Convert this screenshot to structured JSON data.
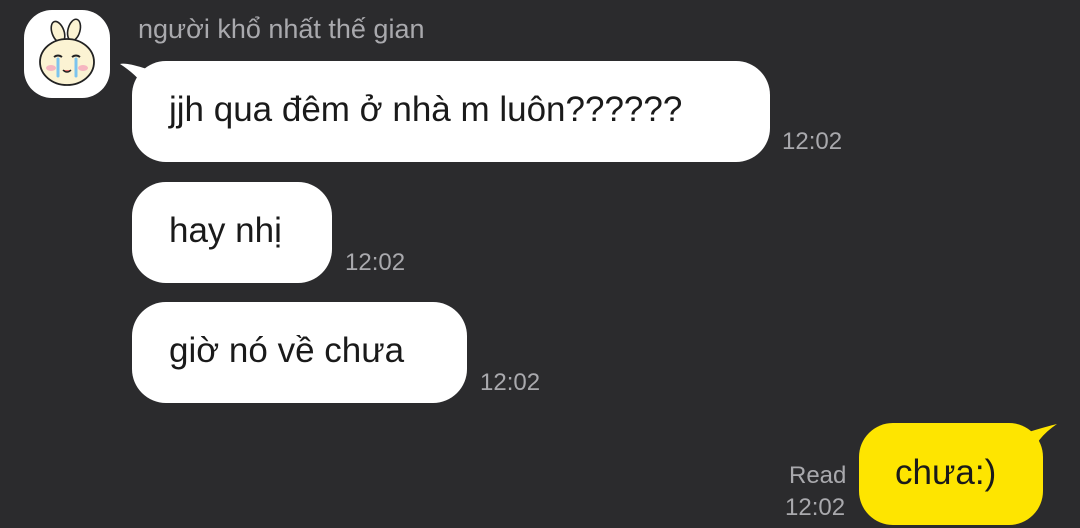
{
  "conversation": {
    "sender_name": "người khổ nhất thế gian",
    "avatar_icon": "crying-bunny-avatar-icon"
  },
  "messages": [
    {
      "direction": "incoming",
      "text": "jjh qua đêm ở nhà m luôn??????",
      "time": "12:02"
    },
    {
      "direction": "incoming",
      "text": "hay nhị",
      "time": "12:02"
    },
    {
      "direction": "incoming",
      "text": "giờ nó về chưa",
      "time": "12:02"
    },
    {
      "direction": "outgoing",
      "text": "chưa:)",
      "time": "12:02",
      "status": "Read"
    }
  ],
  "colors": {
    "background": "#2b2b2d",
    "incoming_bubble": "#ffffff",
    "outgoing_bubble": "#fee500",
    "meta_text": "#a9a9ad"
  }
}
